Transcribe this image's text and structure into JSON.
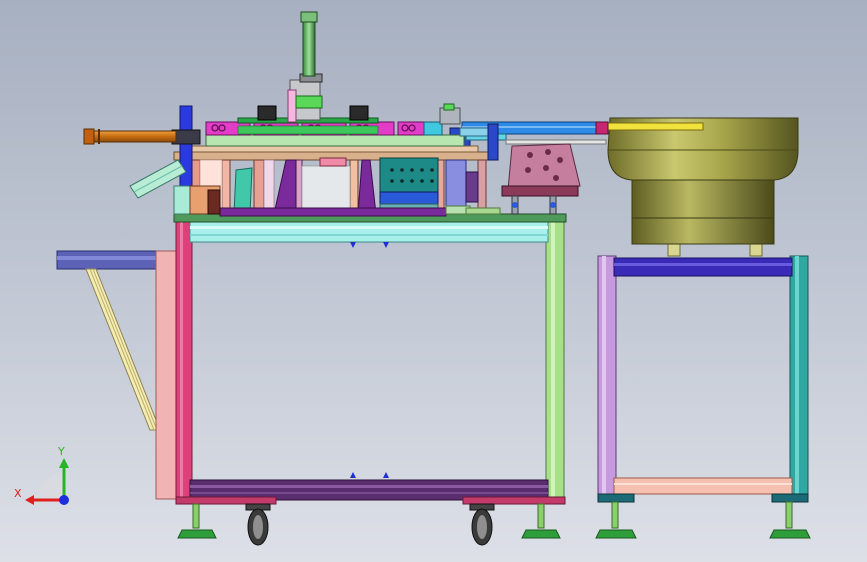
{
  "viewport": {
    "background_top": "#a7b0c1",
    "background_bottom": "#dde0e7"
  },
  "triad": {
    "x_label": "X",
    "y_label": "Y",
    "x_color": "#e0201c",
    "y_color": "#27b527",
    "z_color": "#1d2fd8"
  },
  "model": {
    "palette": {
      "frame_cyan": "#a8f0ec",
      "frame_green": "#a8e08a",
      "frame_pink": "#e0407a",
      "frame_purple": "#5a2d6e",
      "bowl_olive": "#a6a54a",
      "feeder_rail": "#2d8ae6",
      "rail_yellow": "#f2e23c",
      "magenta": "#e83ec8"
    }
  }
}
